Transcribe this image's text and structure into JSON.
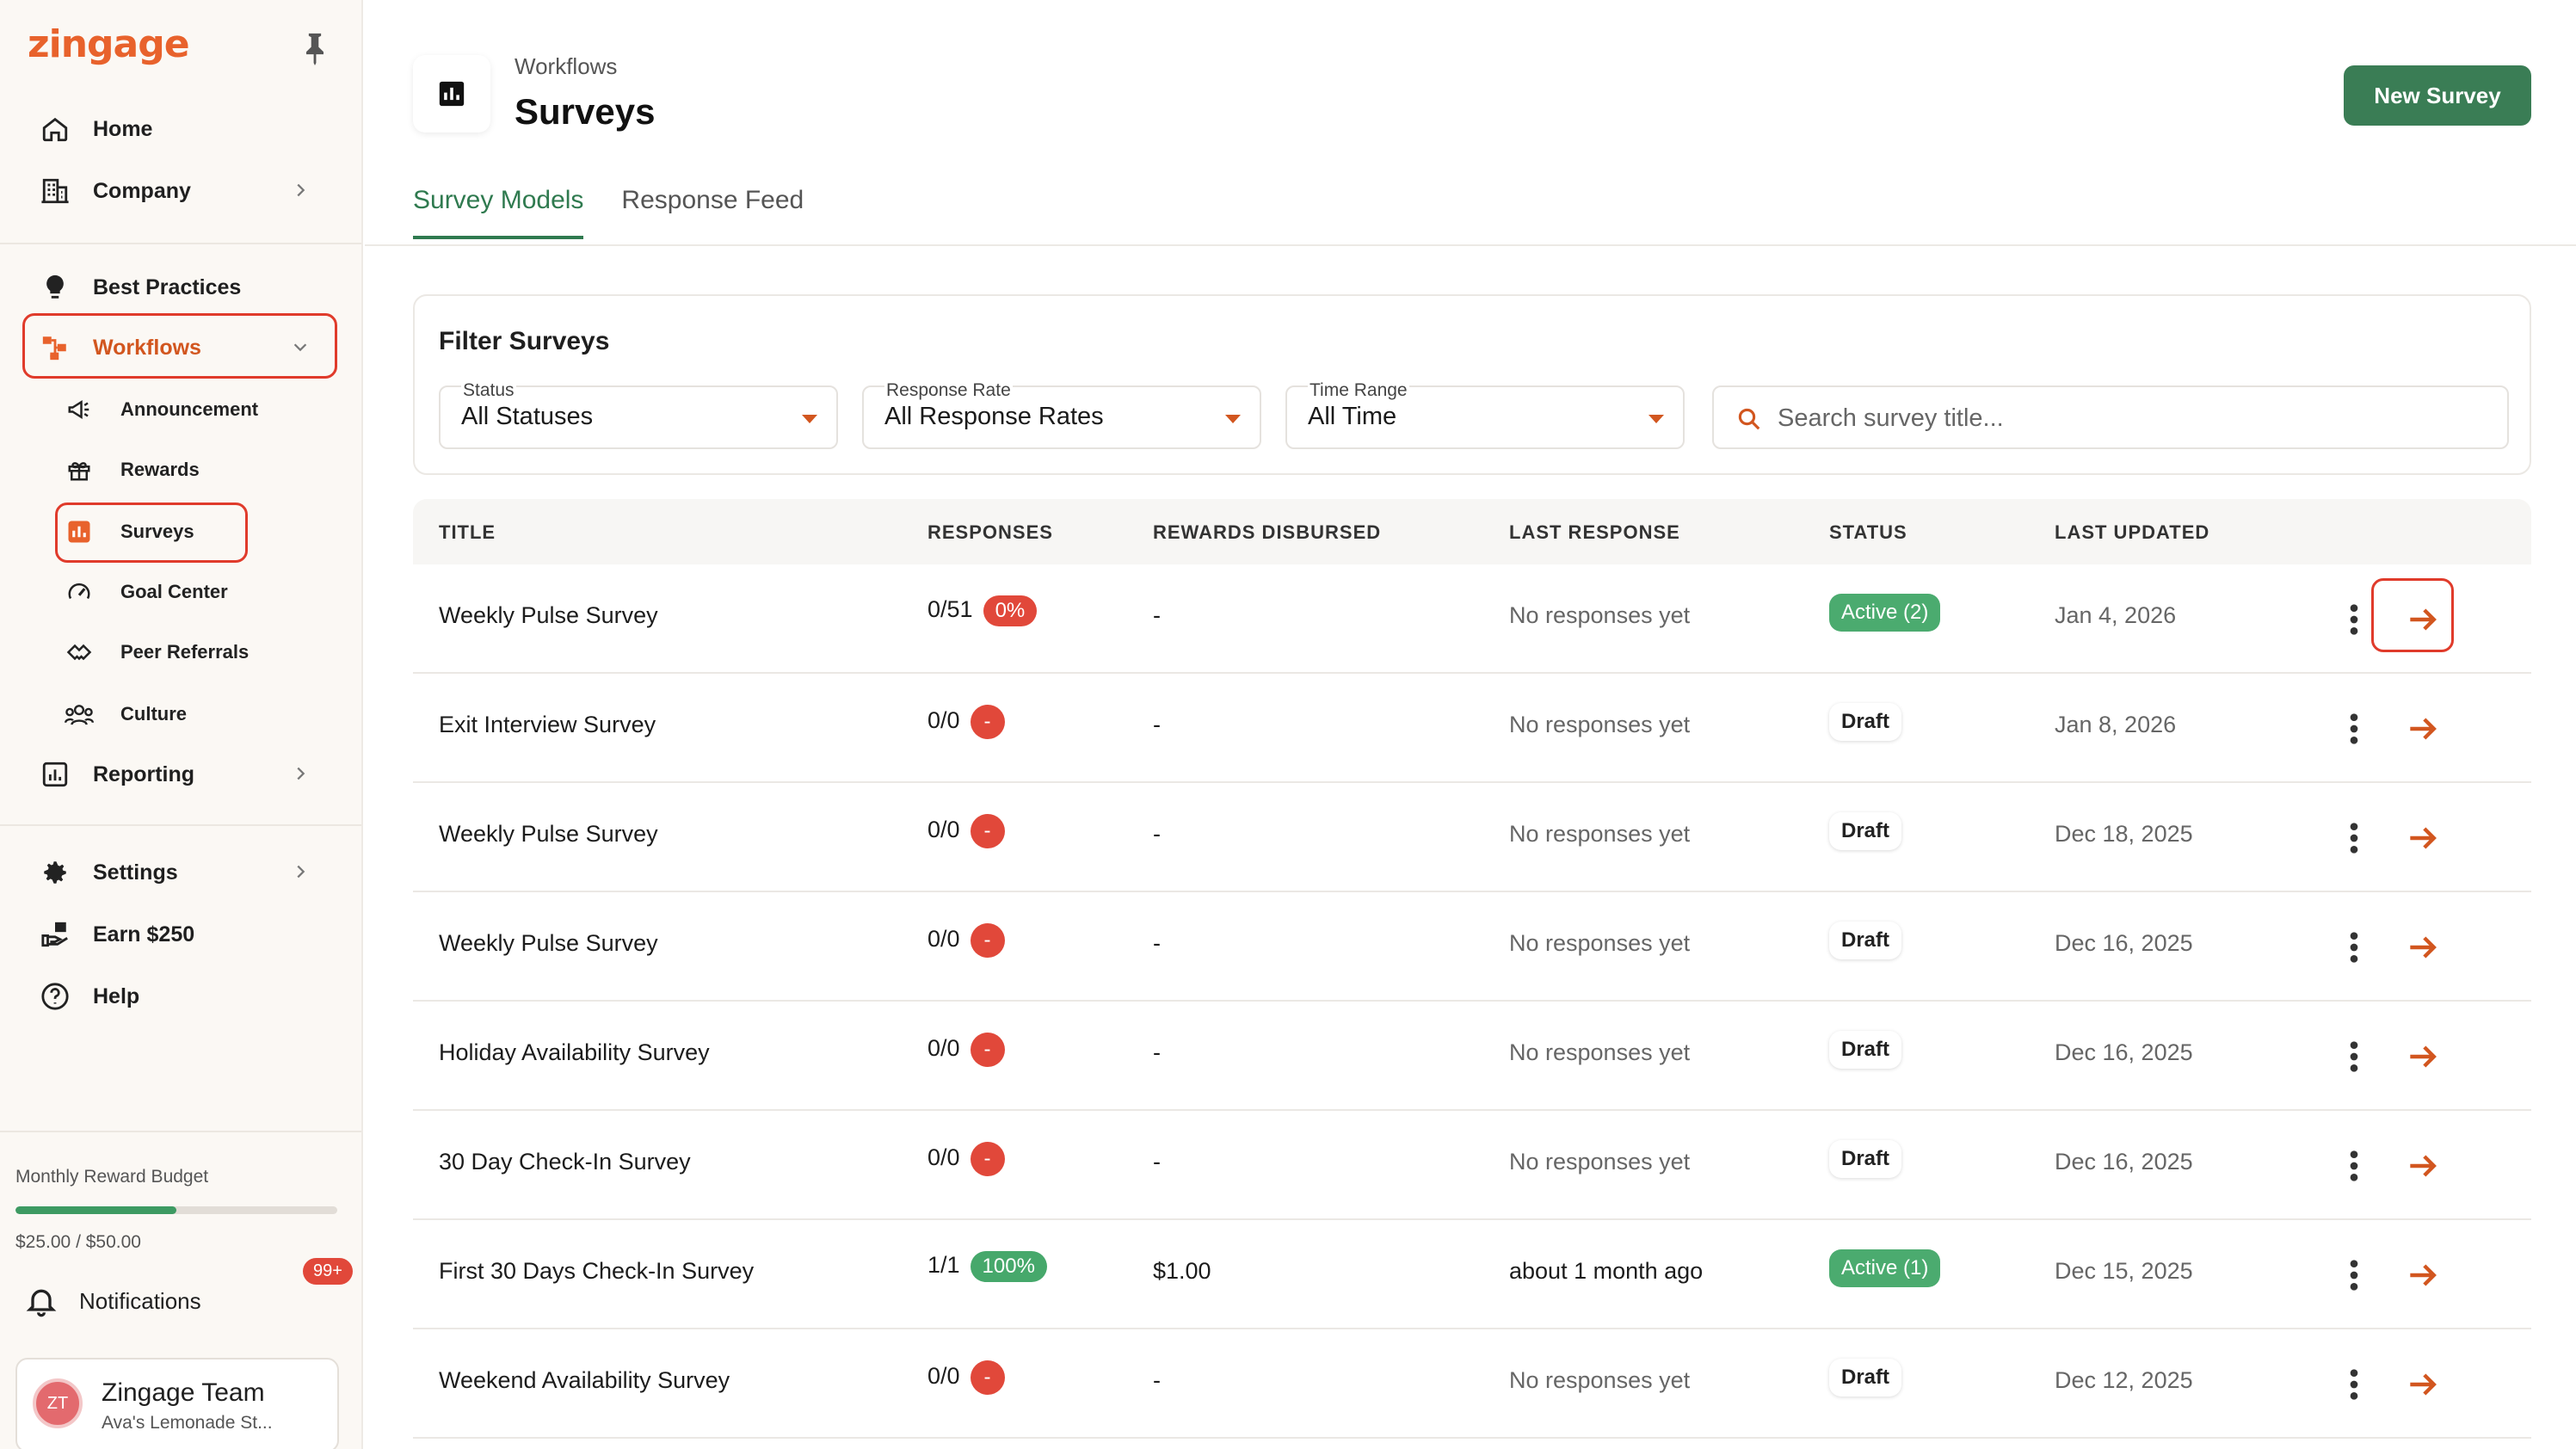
{
  "app": {
    "logo": "zingage"
  },
  "sidebar": {
    "items": [
      {
        "label": "Home",
        "icon": "home-icon"
      },
      {
        "label": "Company",
        "icon": "building-icon"
      },
      {
        "label": "Best Practices",
        "icon": "lightbulb-icon"
      },
      {
        "label": "Workflows",
        "icon": "workflow-icon"
      },
      {
        "label": "Reporting",
        "icon": "chart-icon"
      },
      {
        "label": "Settings",
        "icon": "gear-icon"
      },
      {
        "label": "Earn $250",
        "icon": "gift-hand-icon"
      },
      {
        "label": "Help",
        "icon": "help-icon"
      }
    ],
    "subitems": [
      {
        "label": "Announcement",
        "icon": "megaphone-icon"
      },
      {
        "label": "Rewards",
        "icon": "gift-icon"
      },
      {
        "label": "Surveys",
        "icon": "survey-icon"
      },
      {
        "label": "Goal Center",
        "icon": "gauge-icon"
      },
      {
        "label": "Peer Referrals",
        "icon": "handshake-icon"
      },
      {
        "label": "Culture",
        "icon": "people-icon"
      }
    ],
    "budget": {
      "label": "Monthly Reward Budget",
      "value": "$25.00 / $50.00",
      "fraction": 0.5
    },
    "notifications": {
      "label": "Notifications",
      "badge": "99+"
    },
    "user": {
      "initials": "ZT",
      "name": "Zingage Team",
      "org": "Ava's Lemonade St..."
    }
  },
  "header": {
    "breadcrumb": "Workflows",
    "title": "Surveys",
    "new_button": "New Survey"
  },
  "tabs": [
    {
      "label": "Survey Models",
      "active": true
    },
    {
      "label": "Response Feed",
      "active": false
    }
  ],
  "filters": {
    "title": "Filter Surveys",
    "status": {
      "caption": "Status",
      "value": "All Statuses"
    },
    "response_rate": {
      "caption": "Response Rate",
      "value": "All Response Rates"
    },
    "time_range": {
      "caption": "Time Range",
      "value": "All Time"
    },
    "search_placeholder": "Search survey title..."
  },
  "table": {
    "columns": [
      "TITLE",
      "RESPONSES",
      "REWARDS DISBURSED",
      "LAST RESPONSE",
      "STATUS",
      "LAST UPDATED"
    ],
    "rows": [
      {
        "title": "Weekly Pulse Survey",
        "responses": "0/51",
        "rate": "0%",
        "rate_color": "red",
        "rewards": "-",
        "last_response": "No responses yet",
        "status": "Active (2)",
        "status_type": "active",
        "updated": "Jan 4, 2026"
      },
      {
        "title": "Exit Interview Survey",
        "responses": "0/0",
        "rate": "-",
        "rate_color": "red",
        "rewards": "-",
        "last_response": "No responses yet",
        "status": "Draft",
        "status_type": "draft",
        "updated": "Jan 8, 2026"
      },
      {
        "title": "Weekly Pulse Survey",
        "responses": "0/0",
        "rate": "-",
        "rate_color": "red",
        "rewards": "-",
        "last_response": "No responses yet",
        "status": "Draft",
        "status_type": "draft",
        "updated": "Dec 18, 2025"
      },
      {
        "title": "Weekly Pulse Survey",
        "responses": "0/0",
        "rate": "-",
        "rate_color": "red",
        "rewards": "-",
        "last_response": "No responses yet",
        "status": "Draft",
        "status_type": "draft",
        "updated": "Dec 16, 2025"
      },
      {
        "title": "Holiday Availability Survey",
        "responses": "0/0",
        "rate": "-",
        "rate_color": "red",
        "rewards": "-",
        "last_response": "No responses yet",
        "status": "Draft",
        "status_type": "draft",
        "updated": "Dec 16, 2025"
      },
      {
        "title": "30 Day Check-In Survey",
        "responses": "0/0",
        "rate": "-",
        "rate_color": "red",
        "rewards": "-",
        "last_response": "No responses yet",
        "status": "Draft",
        "status_type": "draft",
        "updated": "Dec 16, 2025"
      },
      {
        "title": "First 30 Days Check-In Survey",
        "responses": "1/1",
        "rate": "100%",
        "rate_color": "green",
        "rewards": "$1.00",
        "last_response": "about 1 month ago",
        "status": "Active (1)",
        "status_type": "active",
        "updated": "Dec 15, 2025"
      },
      {
        "title": "Weekend Availability Survey",
        "responses": "0/0",
        "rate": "-",
        "rate_color": "red",
        "rewards": "-",
        "last_response": "No responses yet",
        "status": "Draft",
        "status_type": "draft",
        "updated": "Dec 12, 2025"
      }
    ]
  },
  "colors": {
    "brand": "#e8622c",
    "accent_green": "#3a7d55",
    "danger": "#e1483a",
    "success": "#46a86b"
  }
}
